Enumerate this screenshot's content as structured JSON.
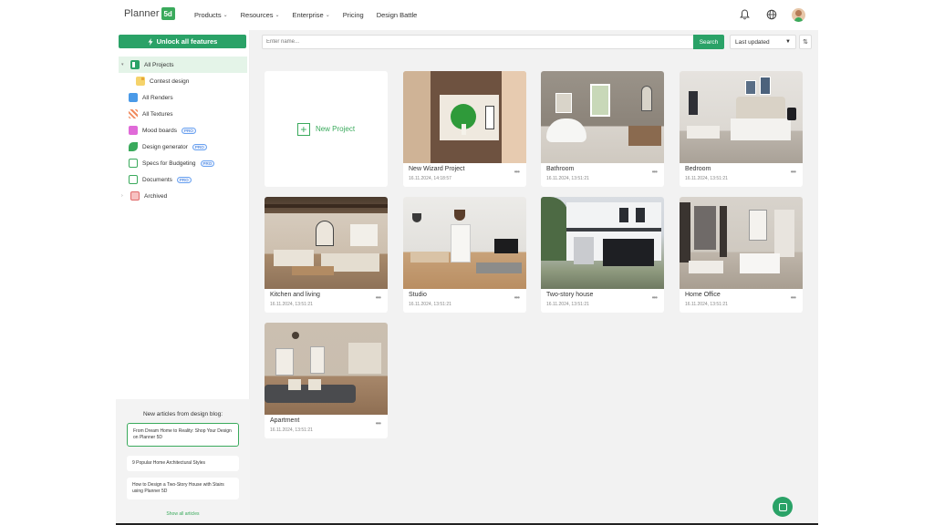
{
  "header": {
    "logo_text": "Planner",
    "logo_badge": "5d",
    "nav": [
      {
        "label": "Products",
        "dropdown": true
      },
      {
        "label": "Resources",
        "dropdown": true
      },
      {
        "label": "Enterprise",
        "dropdown": true
      },
      {
        "label": "Pricing",
        "dropdown": false
      },
      {
        "label": "Design Battle",
        "dropdown": false
      }
    ],
    "icons": [
      "bell-icon",
      "globe-icon",
      "avatar"
    ]
  },
  "sidebar": {
    "unlock_label": "Unlock all features",
    "items": [
      {
        "label": "All Projects",
        "icon": "projects-icon",
        "active": true
      },
      {
        "label": "Contest design",
        "icon": "folder-icon",
        "sub": true
      },
      {
        "label": "All Renders",
        "icon": "renders-icon"
      },
      {
        "label": "All Textures",
        "icon": "textures-icon"
      },
      {
        "label": "Mood boards",
        "icon": "moodboard-icon",
        "badge": "PRO"
      },
      {
        "label": "Design generator",
        "icon": "generator-icon",
        "badge": "PRO"
      },
      {
        "label": "Specs for Budgeting",
        "icon": "specs-icon",
        "badge": "PRO"
      },
      {
        "label": "Documents",
        "icon": "documents-icon",
        "badge": "PRO"
      },
      {
        "label": "Archived",
        "icon": "archive-icon"
      }
    ],
    "blog": {
      "title": "New articles from design blog:",
      "articles": [
        "From Dream Home to Reality: Shop Your Design on Planner 5D",
        "9 Popular Home Architectural Styles",
        "How to Design a Two-Story House with Stairs using Planner 5D"
      ],
      "show_all": "Show all articles"
    }
  },
  "toolbar": {
    "search_placeholder": "Enter name...",
    "search_button": "Search",
    "sort_label": "Last updated"
  },
  "projects": {
    "new_label": "New Project",
    "items": [
      {
        "name": "New Wizard Project",
        "date": "16.11.2024, 14:18:57"
      },
      {
        "name": "Bathroom",
        "date": "16.11.2024, 13:51:21"
      },
      {
        "name": "Bedroom",
        "date": "16.11.2024, 13:51:21"
      },
      {
        "name": "Kitchen and living",
        "date": "16.11.2024, 13:51:21"
      },
      {
        "name": "Studio",
        "date": "16.11.2024, 13:51:21"
      },
      {
        "name": "Two-story house",
        "date": "16.11.2024, 13:51:21"
      },
      {
        "name": "Home Office",
        "date": "16.11.2024, 13:51:21"
      },
      {
        "name": "Apartment",
        "date": "16.11.2024, 13:51:21"
      }
    ]
  },
  "colors": {
    "accent": "#2aa267",
    "active_bg": "#e4f4e8",
    "main_bg": "#f2f2f2"
  }
}
